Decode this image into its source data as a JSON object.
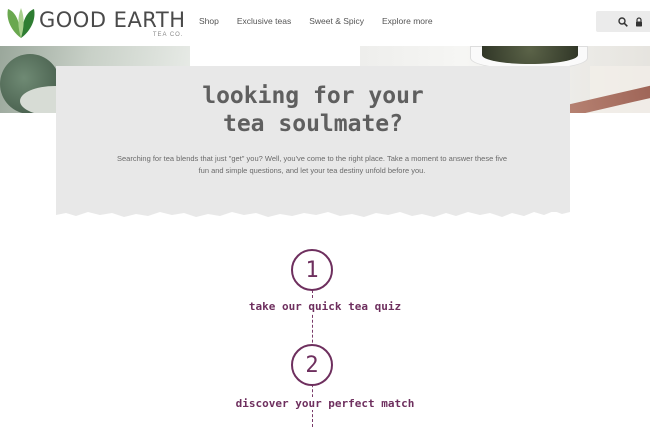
{
  "brand": {
    "name": "GOOD EARTH",
    "sub": "TEA CO.",
    "leaf_colors": [
      "#6aa84f",
      "#a8d08d",
      "#2e7d32"
    ]
  },
  "nav": {
    "items": [
      "Shop",
      "Exclusive teas",
      "Sweet & Spicy",
      "Explore more"
    ]
  },
  "toolbar": {
    "icons": [
      "search-icon",
      "lock-icon"
    ]
  },
  "hero": {
    "headline_line1": "looking for your",
    "headline_line2": "tea soulmate?",
    "blurb": "Searching for tea blends that just \"get\" you? Well, you've come to the right place. Take a moment to answer these five fun and simple questions, and let your tea destiny unfold before you."
  },
  "steps": [
    {
      "number": "1",
      "label": "take our quick tea quiz"
    },
    {
      "number": "2",
      "label": "discover your perfect match"
    }
  ],
  "colors": {
    "accent": "#6e2f5e",
    "card": "#e8e8e8",
    "text": "#5f5f5f"
  }
}
